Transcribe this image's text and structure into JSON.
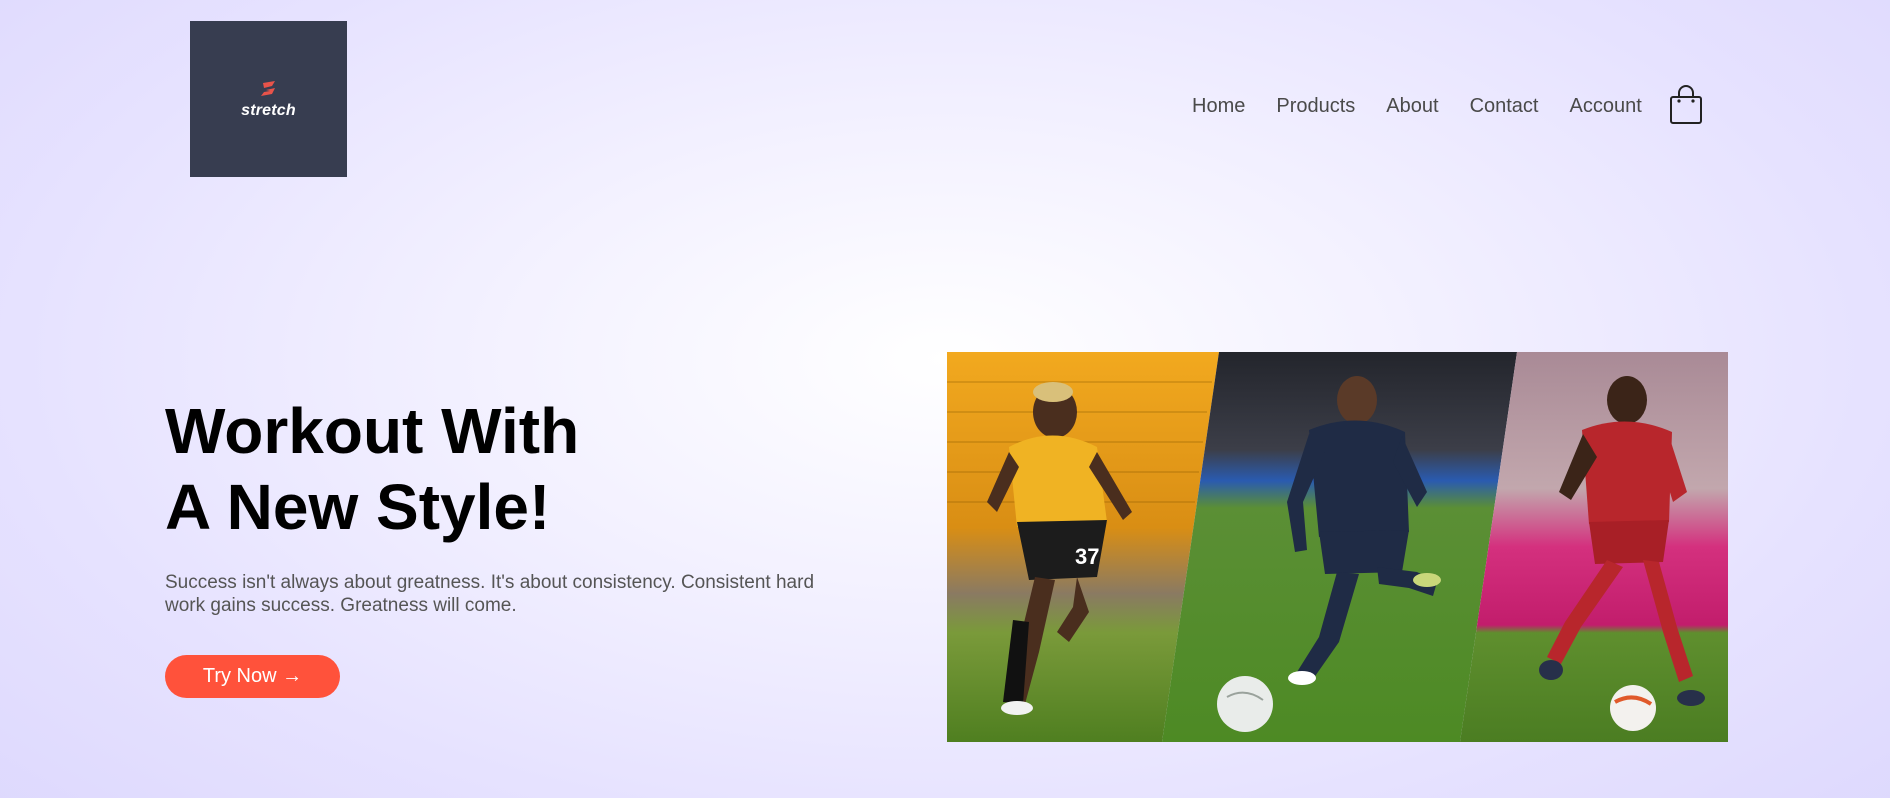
{
  "brand": {
    "name": "stretch",
    "accent_color": "#ff523b",
    "logo_bg": "#373d50"
  },
  "nav": {
    "items": [
      {
        "label": "Home"
      },
      {
        "label": "Products"
      },
      {
        "label": "About"
      },
      {
        "label": "Contact"
      },
      {
        "label": "Account"
      }
    ],
    "cart_icon": "shopping-bag-icon"
  },
  "hero": {
    "title_line1": "Workout With",
    "title_line2": "A New Style!",
    "subtitle": "Success isn't always about greatness. It's about consistency. Consistent hard work gains success. Greatness will come.",
    "cta_label": "Try Now →",
    "image_jersey_number": "37"
  }
}
